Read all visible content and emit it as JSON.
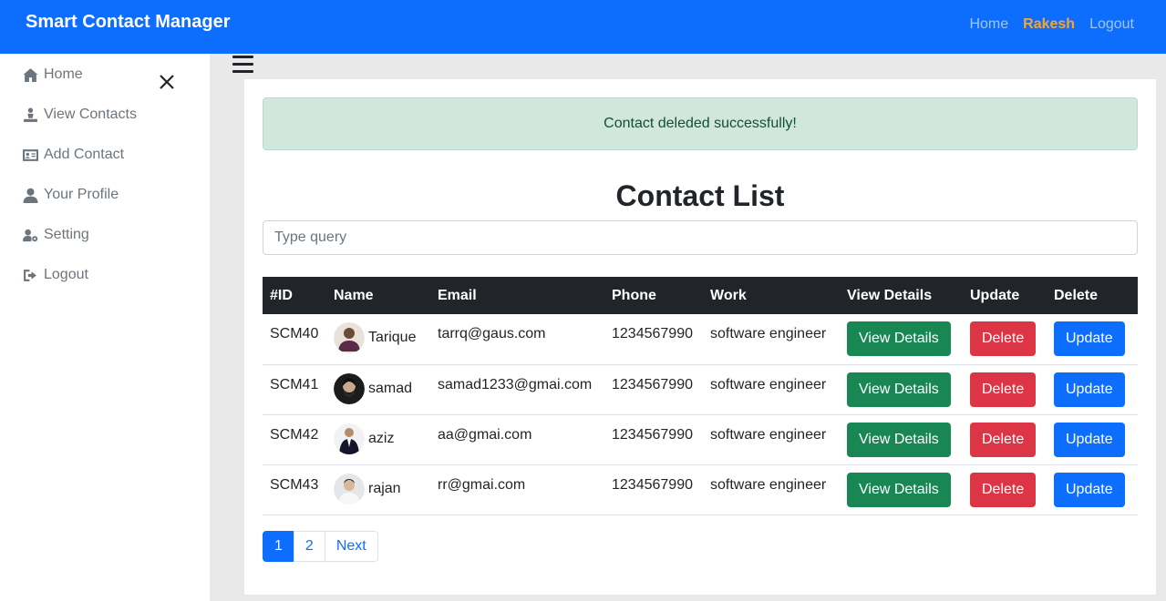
{
  "navbar": {
    "brand": "Smart Contact Manager",
    "links": {
      "home": "Home",
      "user": "Rakesh",
      "logout": "Logout"
    },
    "accent_color": "#0d6efd",
    "user_color": "#f6a531"
  },
  "sidebar": {
    "items": [
      {
        "label": "Home",
        "icon": "home-icon"
      },
      {
        "label": "View Contacts",
        "icon": "contacts-icon"
      },
      {
        "label": "Add Contact",
        "icon": "id-card-icon"
      },
      {
        "label": "Your Profile",
        "icon": "user-icon"
      },
      {
        "label": "Setting",
        "icon": "user-gear-icon"
      },
      {
        "label": "Logout",
        "icon": "logout-icon"
      }
    ]
  },
  "alert": {
    "message": "Contact deleded successfully!"
  },
  "main": {
    "title": "Contact List",
    "search_placeholder": "Type query"
  },
  "table": {
    "headers": [
      "#ID",
      "Name",
      "Email",
      "Phone",
      "Work",
      "View Details",
      "Update",
      "Delete"
    ],
    "rows": [
      {
        "id": "SCM40",
        "name": "Tarique",
        "email": "tarrq@gaus.com",
        "phone": "1234567990",
        "work": "software engineer",
        "view": "View Details",
        "delete": "Delete",
        "update": "Update"
      },
      {
        "id": "SCM41",
        "name": "samad",
        "email": "samad1233@gmai.com",
        "phone": "1234567990",
        "work": "software engineer",
        "view": "View Details",
        "delete": "Delete",
        "update": "Update"
      },
      {
        "id": "SCM42",
        "name": "aziz",
        "email": "aa@gmai.com",
        "phone": "1234567990",
        "work": "software engineer",
        "view": "View Details",
        "delete": "Delete",
        "update": "Update"
      },
      {
        "id": "SCM43",
        "name": "rajan",
        "email": "rr@gmai.com",
        "phone": "1234567990",
        "work": "software engineer",
        "view": "View Details",
        "delete": "Delete",
        "update": "Update"
      }
    ]
  },
  "pagination": {
    "pages": [
      "1",
      "2"
    ],
    "next": "Next",
    "active": "1"
  }
}
